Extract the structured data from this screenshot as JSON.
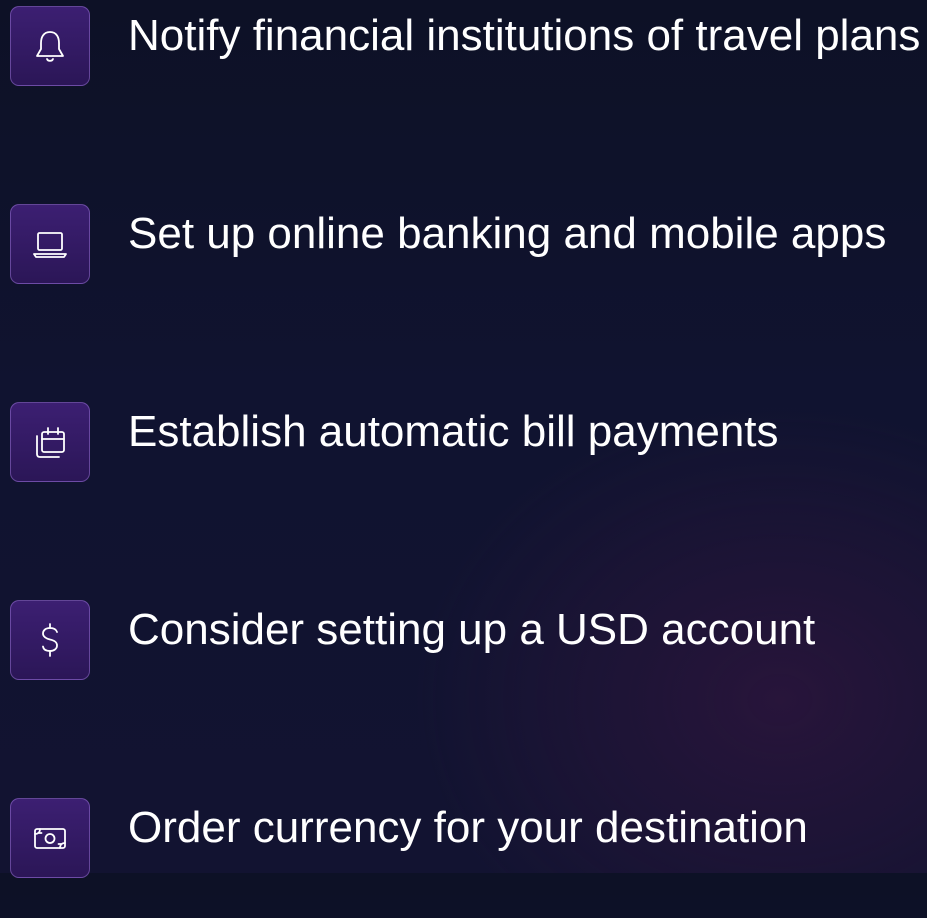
{
  "items": [
    {
      "icon": "bell-icon",
      "label": "Notify financial institutions of travel plans"
    },
    {
      "icon": "laptop-icon",
      "label": "Set up online banking and mobile apps"
    },
    {
      "icon": "calendar-icon",
      "label": "Establish automatic bill payments"
    },
    {
      "icon": "dollar-icon",
      "label": "Consider setting up a USD account"
    },
    {
      "icon": "banknote-icon",
      "label": "Order currency for your destination"
    }
  ],
  "colors": {
    "background": "#0f1230",
    "icon_box": "#351b66",
    "icon_stroke": "#ffffff",
    "text": "#ffffff"
  }
}
